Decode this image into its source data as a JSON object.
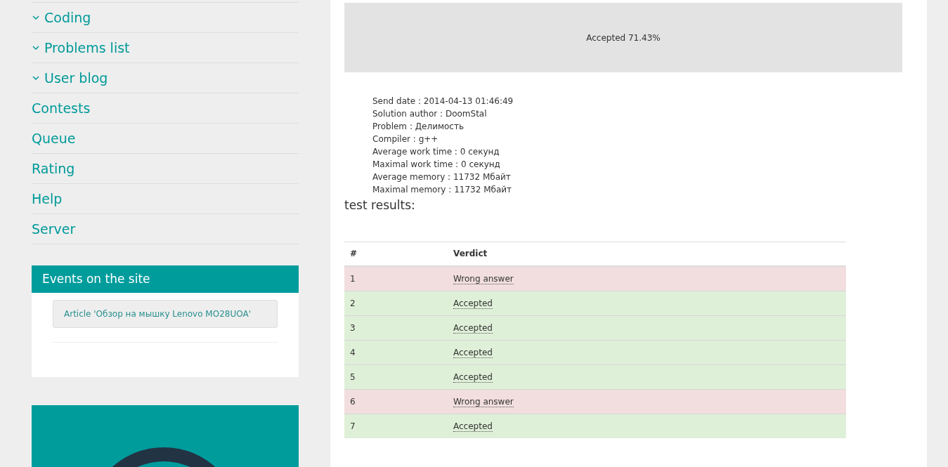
{
  "sidebar": {
    "items": [
      {
        "label": "Coding",
        "kind": "dropdown"
      },
      {
        "label": "Problems list",
        "kind": "dropdown"
      },
      {
        "label": "User blog",
        "kind": "dropdown"
      },
      {
        "label": "Contests",
        "kind": "link"
      },
      {
        "label": "Queue",
        "kind": "link"
      },
      {
        "label": "Rating",
        "kind": "link"
      },
      {
        "label": "Help",
        "kind": "link"
      },
      {
        "label": "Server",
        "kind": "link"
      }
    ]
  },
  "events": {
    "title": "Events on the site",
    "items": [
      "Article 'Обзор на мышку Lenovo MO28UOA'"
    ]
  },
  "summary": {
    "label": "Accepted 71.43%"
  },
  "details": [
    "Send date : 2014-04-13 01:46:49",
    "Solution author : DoomStal",
    "Problem : Делимость",
    "Compiler : g++",
    "Average work time : 0 секунд",
    "Maximal work time : 0 секунд",
    "Average memory : 11732 Мбайт",
    "Maximal memory : 11732 Мбайт"
  ],
  "results": {
    "title": "test results:",
    "columns": [
      "#",
      "Verdict"
    ],
    "rows": [
      {
        "number": "1",
        "verdict": "Wrong answer",
        "kind": "wrong"
      },
      {
        "number": "2",
        "verdict": "Accepted",
        "kind": "accepted"
      },
      {
        "number": "3",
        "verdict": "Accepted",
        "kind": "accepted"
      },
      {
        "number": "4",
        "verdict": "Accepted",
        "kind": "accepted"
      },
      {
        "number": "5",
        "verdict": "Accepted",
        "kind": "accepted"
      },
      {
        "number": "6",
        "verdict": "Wrong answer",
        "kind": "wrong"
      },
      {
        "number": "7",
        "verdict": "Accepted",
        "kind": "accepted"
      }
    ]
  }
}
